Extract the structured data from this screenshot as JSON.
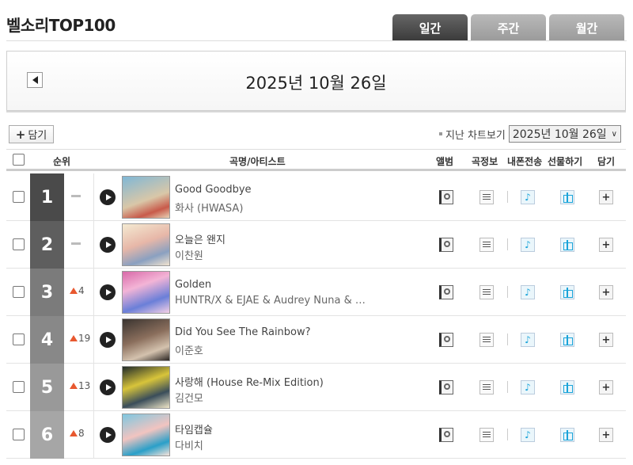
{
  "header": {
    "title": "벨소리TOP100"
  },
  "tabs": [
    {
      "label": "일간",
      "active": true
    },
    {
      "label": "주간",
      "active": false
    },
    {
      "label": "월간",
      "active": false
    }
  ],
  "datebar": {
    "date": "2025년 10월 26일"
  },
  "toolbar": {
    "add_label": "담기",
    "past_chart_label": "지난 차트보기",
    "past_chart_selected": "2025년 10월 26일"
  },
  "columns": {
    "rank": "순위",
    "song_artist": "곡명/아티스트",
    "album": "앨범",
    "song_info": "곡정보",
    "phone_send": "내폰전송",
    "gift": "선물하기",
    "add": "담기"
  },
  "colors": {
    "rank_1": "#4a4a4a",
    "rank_2": "#5e5e5e",
    "rank_3": "#7b7b7b",
    "rank_4": "#888888",
    "rank_5": "#999999",
    "rank_6": "#a6a6a6",
    "up_arrow": "#e8582f",
    "accent_blue": "#1aa3d9"
  },
  "rows": [
    {
      "rank": "1",
      "change_type": "same",
      "change": "",
      "title": "Good Goodbye",
      "artist": "화사 (HWASA)"
    },
    {
      "rank": "2",
      "change_type": "same",
      "change": "",
      "title": "오늘은 왠지",
      "artist": "이찬원"
    },
    {
      "rank": "3",
      "change_type": "up",
      "change": "4",
      "title": "Golden",
      "artist": "HUNTR/X & EJAE & Audrey Nuna & …"
    },
    {
      "rank": "4",
      "change_type": "up",
      "change": "19",
      "title": "Did You See The Rainbow?",
      "artist": "이준호"
    },
    {
      "rank": "5",
      "change_type": "up",
      "change": "13",
      "title": "사랑해 (House Re-Mix Edition)",
      "artist": "김건모"
    },
    {
      "rank": "6",
      "change_type": "up",
      "change": "8",
      "title": "타임캡슐",
      "artist": "다비치"
    }
  ]
}
